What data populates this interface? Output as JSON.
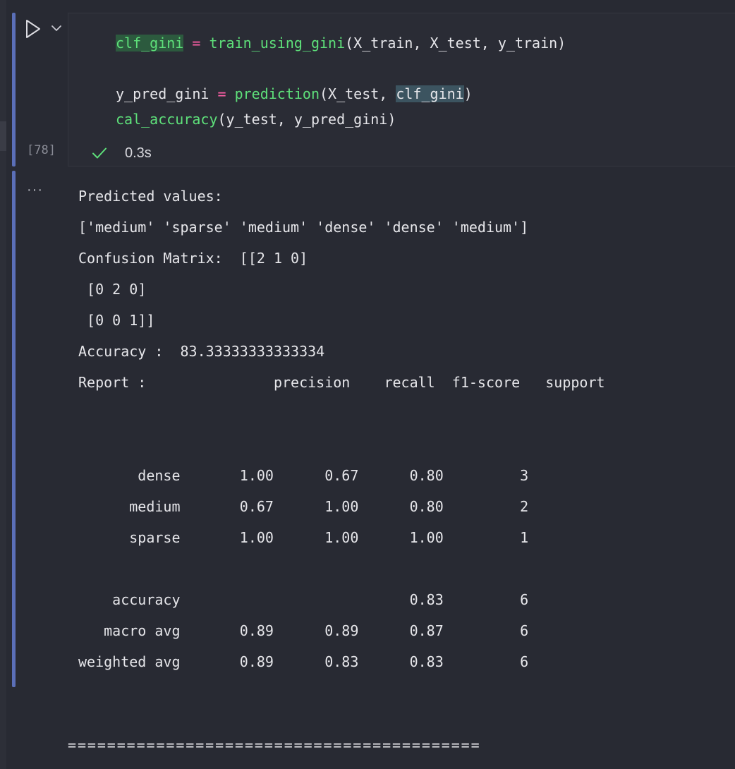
{
  "cell": {
    "execution_count": "[78]",
    "status_time": "0.3s",
    "code": {
      "line1": {
        "var": "clf_gini",
        "op": "=",
        "fn": "train_using_gini",
        "args": "(X_train, X_test, y_train)"
      },
      "line2": {
        "var": "y_pred_gini",
        "op": "=",
        "fn": "prediction",
        "args_open": "(X_test, ",
        "highlight": "clf_gini",
        "close": ")"
      },
      "line3": {
        "fn": "cal_accuracy",
        "args": "(y_test, y_pred_gini)"
      }
    }
  },
  "output": {
    "more_label": "···",
    "text": "Predicted values:\n['medium' 'sparse' 'medium' 'dense' 'dense' 'medium']\nConfusion Matrix:  [[2 1 0]\n [0 2 0]\n [0 0 1]]\nAccuracy :  83.33333333333334\nReport :               precision    recall  f1-score   support\n\n\n       dense       1.00      0.67      0.80         3\n      medium       0.67      1.00      0.80         2\n      sparse       1.00      1.00      1.00         1\n\n    accuracy                           0.83         6\n   macro avg       0.89      0.89      0.87         6\nweighted avg       0.89      0.83      0.83         6",
    "divider": "=========================================="
  },
  "colors": {
    "background": "#282a33",
    "cell_bar": "#5b6fb8",
    "function": "#5ee07a",
    "operator": "#ff5fa8",
    "success_check": "#5ee07a"
  },
  "icons": {
    "run": "play-icon",
    "run_menu": "chevron-down-icon",
    "status": "check-icon",
    "output_actions": "more-icon"
  }
}
